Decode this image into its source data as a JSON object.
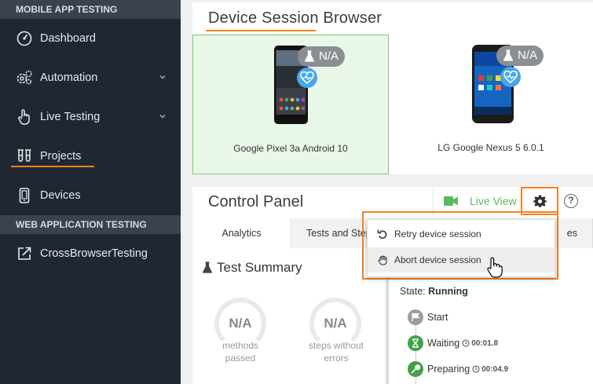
{
  "sidebar": {
    "section1": "MOBILE APP TESTING",
    "items": [
      {
        "label": "Dashboard",
        "icon": "gauge-icon"
      },
      {
        "label": "Automation",
        "icon": "gears-icon"
      },
      {
        "label": "Live Testing",
        "icon": "hand-pointer-icon"
      },
      {
        "label": "Projects",
        "icon": "test-tubes-icon"
      },
      {
        "label": "Devices",
        "icon": "mobile-phone-icon"
      }
    ],
    "section2": "WEB APPLICATION TESTING",
    "items2": [
      {
        "label": "CrossBrowserTesting",
        "icon": "external-link-icon"
      }
    ]
  },
  "browser": {
    "title": "Device Session Browser",
    "devices": [
      {
        "name": "Google Pixel 3a Android 10",
        "badge": "N/A",
        "selected": true
      },
      {
        "name": "LG Google Nexus 5 6.0.1",
        "badge": "N/A",
        "selected": false
      }
    ]
  },
  "control_panel": {
    "title": "Control Panel",
    "live_view": "Live View",
    "help": "?",
    "tabs": [
      "Analytics",
      "Tests and Step",
      "es"
    ],
    "summary_title": "Test Summary",
    "rings": [
      {
        "value": "N/A",
        "label_line1": "methods",
        "label_line2": "passed"
      },
      {
        "value": "N/A",
        "label_line1": "steps without",
        "label_line2": "errors"
      }
    ],
    "state_label": "State:",
    "state_value": "Running",
    "steps": [
      {
        "label": "Start",
        "duration": ""
      },
      {
        "label": "Waiting",
        "duration": "00:01.8"
      },
      {
        "label": "Preparing",
        "duration": "00:04.9"
      }
    ]
  },
  "menu": {
    "items": [
      "Retry device session",
      "Abort device session"
    ]
  },
  "colors": {
    "accent": "#f58220",
    "sidebar_bg": "#1f2733",
    "green": "#5cb85c",
    "blue": "#48a6ea"
  }
}
